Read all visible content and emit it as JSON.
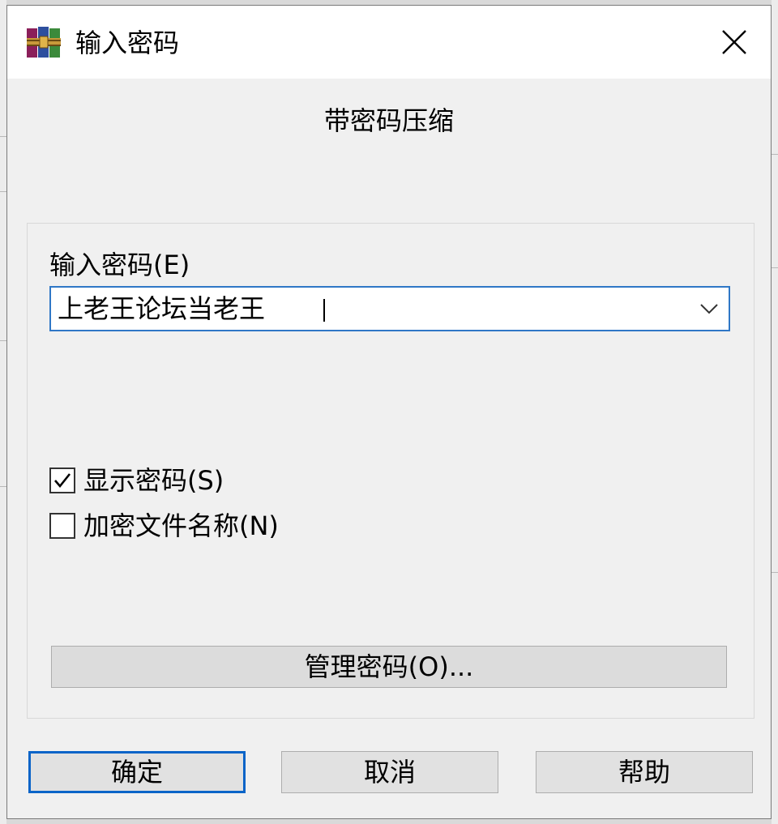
{
  "window": {
    "title": "输入密码",
    "app_icon": "winrar-books-icon",
    "close_icon": "close-x-icon"
  },
  "subtitle": "带密码压缩",
  "password_field": {
    "label": "输入密码(E)",
    "value": "上老王论坛当老王",
    "dropdown_icon": "chevron-down-icon"
  },
  "options": {
    "show_password": {
      "label": "显示密码(S)",
      "checked": true
    },
    "encrypt_names": {
      "label": "加密文件名称(N)",
      "checked": false
    }
  },
  "buttons": {
    "manage": "管理密码(O)...",
    "ok": "确定",
    "cancel": "取消",
    "help": "帮助"
  },
  "colors": {
    "focus_border": "#0a64c8",
    "dialog_bg": "#f0f0f0",
    "titlebar_bg": "#ffffff"
  }
}
